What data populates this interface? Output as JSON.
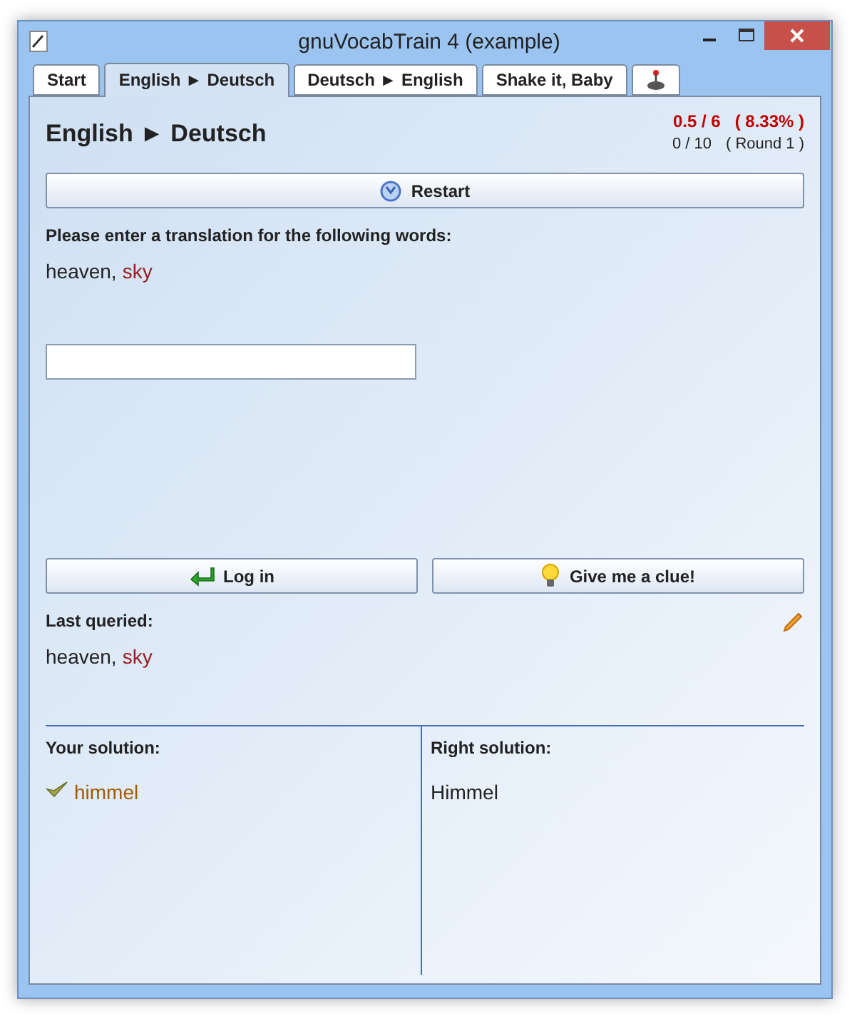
{
  "window": {
    "title": "gnuVocabTrain 4 (example)"
  },
  "tabs": [
    {
      "label": "Start",
      "kind": "text",
      "selected": false
    },
    {
      "label": "English ► Deutsch",
      "kind": "text",
      "selected": true
    },
    {
      "label": "Deutsch ► English",
      "kind": "text",
      "selected": false
    },
    {
      "label": "Shake it, Baby",
      "kind": "text",
      "selected": false
    },
    {
      "kind": "icon",
      "selected": false
    }
  ],
  "heading": "English ► Deutsch",
  "score": {
    "points": "0.5 / 6",
    "percent": "( 8.33% )",
    "progress": "0 / 10",
    "round": "( Round 1 )"
  },
  "restart_button": "Restart",
  "prompt": "Please enter a translation for the following words:",
  "query": {
    "first": "heaven,",
    "second": "sky"
  },
  "login_button": "Log in",
  "clue_button": "Give me a clue!",
  "last_queried": {
    "label": "Last queried:",
    "first": "heaven,",
    "second": "sky"
  },
  "your_solution": {
    "label": "Your solution:",
    "value": "himmel",
    "correct": true
  },
  "right_solution": {
    "label": "Right solution:",
    "value": "Himmel"
  }
}
